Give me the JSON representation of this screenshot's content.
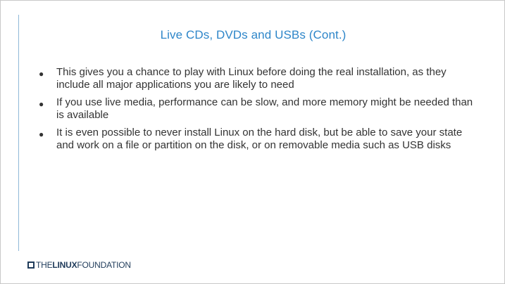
{
  "slide": {
    "title": "Live CDs, DVDs and USBs (Cont.)",
    "bullets": [
      "This gives you a chance to play with Linux before doing the real installation, as they include all major applications you are likely to need",
      "If you use live media, performance can be slow, and more memory might be needed than is available",
      "It is even possible to never install Linux on the hard disk, but be able to save your state and work on a file or partition on the disk, or on removable media such as USB disks"
    ],
    "bullet_symbol": "●"
  },
  "footer": {
    "logo_the": "THE",
    "logo_linux": "LINUX",
    "logo_foundation": "FOUNDATION",
    "logo_icon": "square-outline-icon"
  },
  "colors": {
    "title": "#2e86c9",
    "text": "#333333",
    "rule": "#8fb8d8",
    "logo": "#1f3b5a"
  }
}
